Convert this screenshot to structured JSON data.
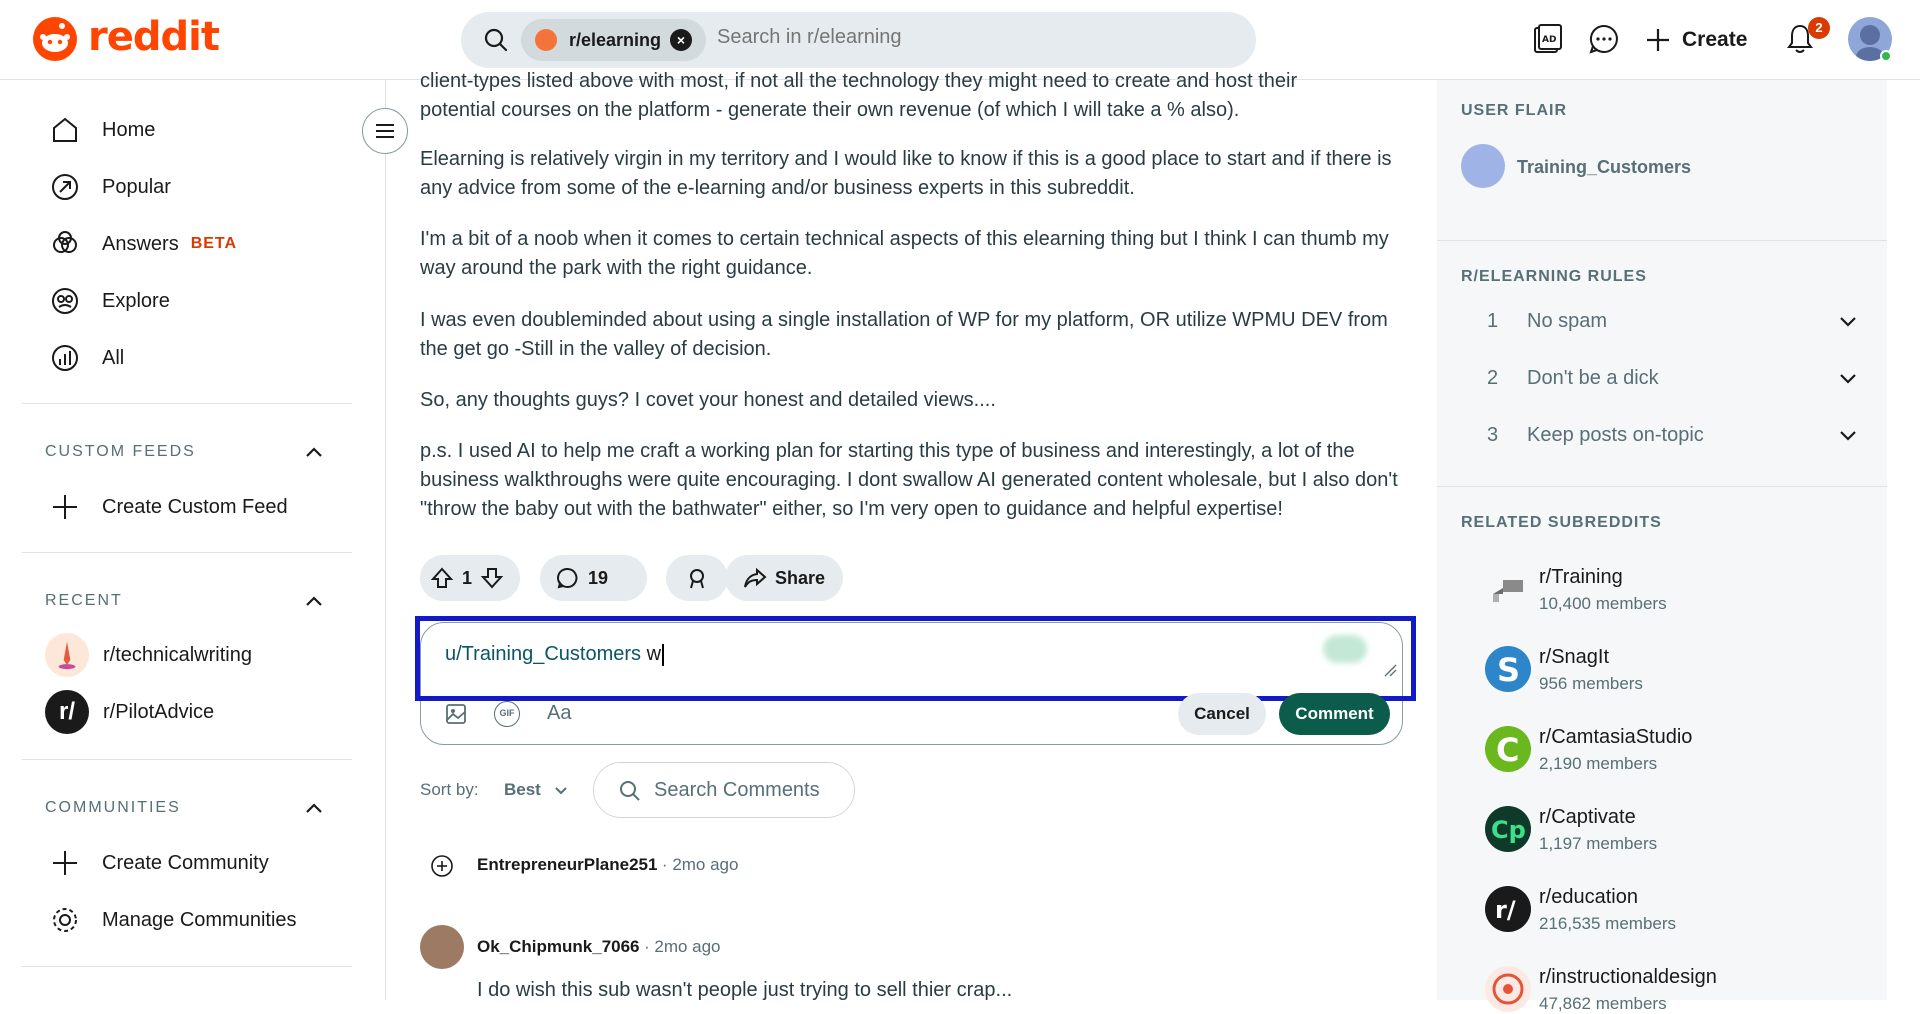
{
  "header": {
    "logo_text": "reddit",
    "search_chip": "r/elearning",
    "search_placeholder": "Search in r/elearning",
    "create_label": "Create",
    "notification_count": "2",
    "brand_color": "#ff4500"
  },
  "left_nav": {
    "items": [
      {
        "label": "Home",
        "icon": "home-icon"
      },
      {
        "label": "Popular",
        "icon": "popular-icon"
      },
      {
        "label": "Answers",
        "icon": "answers-icon",
        "badge": "BETA"
      },
      {
        "label": "Explore",
        "icon": "explore-icon"
      },
      {
        "label": "All",
        "icon": "all-icon"
      }
    ],
    "custom_feeds_header": "CUSTOM FEEDS",
    "create_custom_feed": "Create Custom Feed",
    "recent_header": "RECENT",
    "recent": [
      "r/technicalwriting",
      "r/PilotAdvice"
    ],
    "communities_header": "COMMUNITIES",
    "create_community": "Create Community",
    "manage_communities": "Manage Communities"
  },
  "post": {
    "p0_line1": "client-types listed above with most, if not all the technology they might need to create and host their",
    "p0_line2": "potential courses on the platform - generate their own revenue (of which I will take a % also).",
    "p1": "Elearning is relatively virgin in my territory and I would like to know if this is a good place to start and if there is any advice from some of the e-learning and/or business experts in this subreddit.",
    "p2": "I'm a bit of a noob when it comes to certain technical aspects of this elearning thing but I think I can thumb my way around the park with the right guidance.",
    "p3": "I was even doubleminded about using a single installation of WP for my platform, OR utilize WPMU DEV from the get go -Still in the valley of decision.",
    "p4": "So, any thoughts guys? I covet your honest and detailed views....",
    "p5": "p.s. I used AI to help me craft a working plan for starting this type of business and interestingly, a lot of the business walkthroughs were quite encouraging. I dont swallow AI generated content wholesale, but I also don't \"throw the baby out with the bathwater\" either, so I'm very open to guidance and helpful expertise!",
    "votes": "1",
    "comments": "19",
    "share_label": "Share"
  },
  "composer": {
    "mention": "u/Training_Customers",
    "typed": "w",
    "cancel_label": "Cancel",
    "comment_label": "Comment",
    "format_label": "Aa",
    "gif_label": "GIF"
  },
  "sort": {
    "label": "Sort by:",
    "value": "Best",
    "search_comments": "Search Comments"
  },
  "comments": [
    {
      "author": "EntrepreneurPlane251",
      "time": "2mo ago"
    },
    {
      "author": "Ok_Chipmunk_7066",
      "time": "2mo ago",
      "text": "I do wish this sub wasn't people just trying to sell thier crap..."
    }
  ],
  "sidebar": {
    "user_flair_header": "USER FLAIR",
    "user_flair": "Training_Customers",
    "rules_header": "R/ELEARNING RULES",
    "rules": [
      {
        "num": "1",
        "text": "No spam"
      },
      {
        "num": "2",
        "text": "Don't be a dick"
      },
      {
        "num": "3",
        "text": "Keep posts on-topic"
      }
    ],
    "related_header": "RELATED SUBREDDITS",
    "related": [
      {
        "name": "r/Training",
        "members": "10,400 members"
      },
      {
        "name": "r/SnagIt",
        "members": "956 members"
      },
      {
        "name": "r/CamtasiaStudio",
        "members": "2,190 members"
      },
      {
        "name": "r/Captivate",
        "members": "1,197 members"
      },
      {
        "name": "r/education",
        "members": "216,535 members"
      },
      {
        "name": "r/instructionaldesign",
        "members": "47,862 members"
      }
    ]
  }
}
